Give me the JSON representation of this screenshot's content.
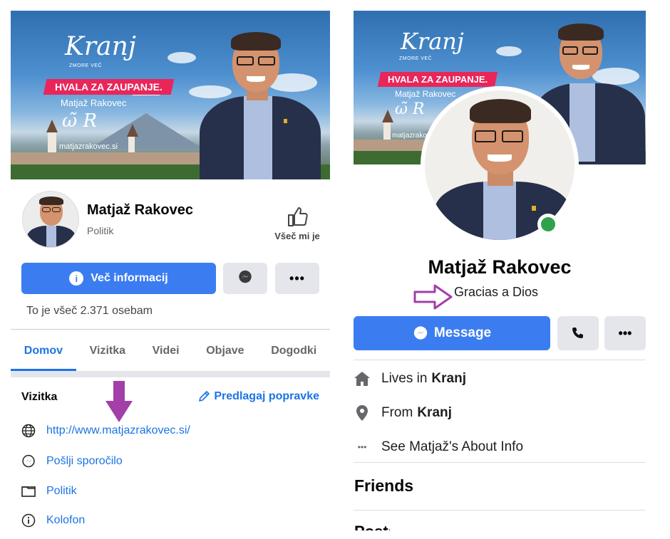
{
  "left": {
    "cover": {
      "brand": "Kranj",
      "brand_sub": "ZMORE VEČ",
      "slogan": "HVALA ZA ZAUPANJE.",
      "name": "Matjaž Rakovec",
      "url": "matjazrakovec.si"
    },
    "page_name": "Matjaž Rakovec",
    "category": "Politik",
    "like_label": "Všeč mi je",
    "more_info_label": "Več informacij",
    "likes_line": "To je všeč 2.371 osebam",
    "tabs": [
      {
        "label": "Domov",
        "active": true
      },
      {
        "label": "Vizitka",
        "active": false
      },
      {
        "label": "Videi",
        "active": false
      },
      {
        "label": "Objave",
        "active": false
      },
      {
        "label": "Dogodki",
        "active": false
      }
    ],
    "vizitka": {
      "title": "Vizitka",
      "suggest_label": "Predlagaj popravke",
      "items": [
        {
          "icon": "globe-icon",
          "text": "http://www.matjazrakovec.si/"
        },
        {
          "icon": "messenger-icon",
          "text": "Pošlji sporočilo"
        },
        {
          "icon": "category-icon",
          "text": "Politik"
        },
        {
          "icon": "info-icon",
          "text": "Kolofon"
        }
      ]
    }
  },
  "right": {
    "cover": {
      "brand": "Kranj",
      "brand_sub": "ZMORE VEČ",
      "slogan": "HVALA ZA ZAUPANJE.",
      "name": "Matjaž Rakovec",
      "url": "matjazrakovec.si"
    },
    "profile_name": "Matjaž Rakovec",
    "bio": "Gracias a Dios",
    "message_label": "Message",
    "details": [
      {
        "icon": "home-icon",
        "prefix": "Lives in",
        "bold": "Kranj"
      },
      {
        "icon": "location-pin-icon",
        "prefix": "From",
        "bold": "Kranj"
      },
      {
        "icon": "more-dots-icon",
        "prefix": "See Matjaž's About Info",
        "bold": ""
      }
    ],
    "friends_heading": "Friends",
    "cutoff_text": "Posts"
  },
  "colors": {
    "facebook_blue": "#1b74e4",
    "button_blue": "#3b7df0",
    "grey_button": "#e4e6eb",
    "online_green": "#31a24c",
    "annotation_purple": "#a23fa8"
  }
}
